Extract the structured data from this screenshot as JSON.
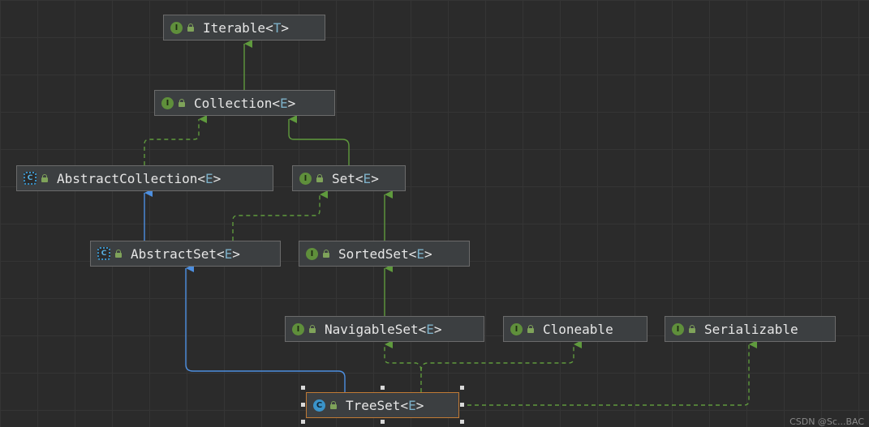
{
  "nodes": {
    "iterable": {
      "name": "Iterable",
      "type_param": "T",
      "kind": "interface"
    },
    "collection": {
      "name": "Collection",
      "type_param": "E",
      "kind": "interface"
    },
    "abstract_collection": {
      "name": "AbstractCollection",
      "type_param": "E",
      "kind": "abstract-class"
    },
    "set": {
      "name": "Set",
      "type_param": "E",
      "kind": "interface"
    },
    "abstract_set": {
      "name": "AbstractSet",
      "type_param": "E",
      "kind": "abstract-class"
    },
    "sorted_set": {
      "name": "SortedSet",
      "type_param": "E",
      "kind": "interface"
    },
    "navigable_set": {
      "name": "NavigableSet",
      "type_param": "E",
      "kind": "interface"
    },
    "cloneable": {
      "name": "Cloneable",
      "kind": "interface"
    },
    "serializable": {
      "name": "Serializable",
      "kind": "interface"
    },
    "tree_set": {
      "name": "TreeSet",
      "type_param": "E",
      "kind": "class",
      "selected": true
    }
  },
  "icons": {
    "interface": {
      "glyph": "I",
      "color": "#5f8f3b"
    },
    "class": {
      "glyph": "C",
      "color": "#3a93c9"
    },
    "abstract": {
      "glyph": "C"
    }
  },
  "edge_colors": {
    "extends": "#4d8fe0",
    "implements": "#5f9a3d"
  },
  "edges": [
    {
      "from": "Collection",
      "to": "Iterable",
      "type": "extends-interface"
    },
    {
      "from": "AbstractCollection",
      "to": "Collection",
      "type": "implements"
    },
    {
      "from": "Set",
      "to": "Collection",
      "type": "extends-interface"
    },
    {
      "from": "AbstractSet",
      "to": "AbstractCollection",
      "type": "extends"
    },
    {
      "from": "AbstractSet",
      "to": "Set",
      "type": "implements"
    },
    {
      "from": "SortedSet",
      "to": "Set",
      "type": "extends-interface"
    },
    {
      "from": "NavigableSet",
      "to": "SortedSet",
      "type": "extends-interface"
    },
    {
      "from": "TreeSet",
      "to": "AbstractSet",
      "type": "extends"
    },
    {
      "from": "TreeSet",
      "to": "NavigableSet",
      "type": "implements"
    },
    {
      "from": "TreeSet",
      "to": "Cloneable",
      "type": "implements"
    },
    {
      "from": "TreeSet",
      "to": "Serializable",
      "type": "implements"
    }
  ],
  "watermark": "CSDN @Sc...BAC"
}
